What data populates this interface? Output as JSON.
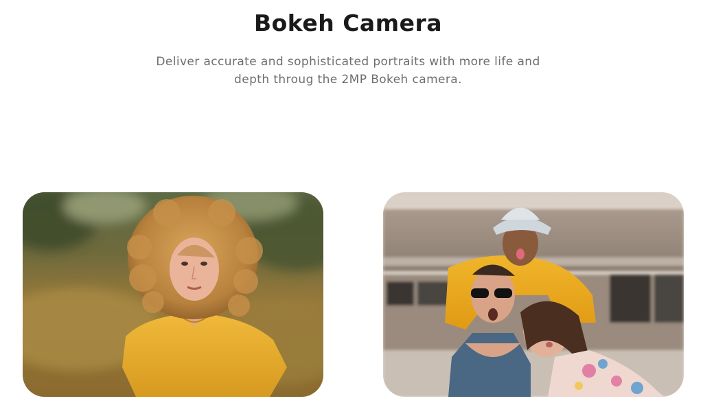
{
  "section": {
    "title": "Bokeh Camera",
    "subtitle_line1": "Deliver accurate and sophisticated portraits with more life and",
    "subtitle_line2": "depth throug the 2MP Bokeh camera."
  },
  "photos": [
    {
      "name": "portrait-curly-hair-woman"
    },
    {
      "name": "group-selfie-friends"
    }
  ]
}
